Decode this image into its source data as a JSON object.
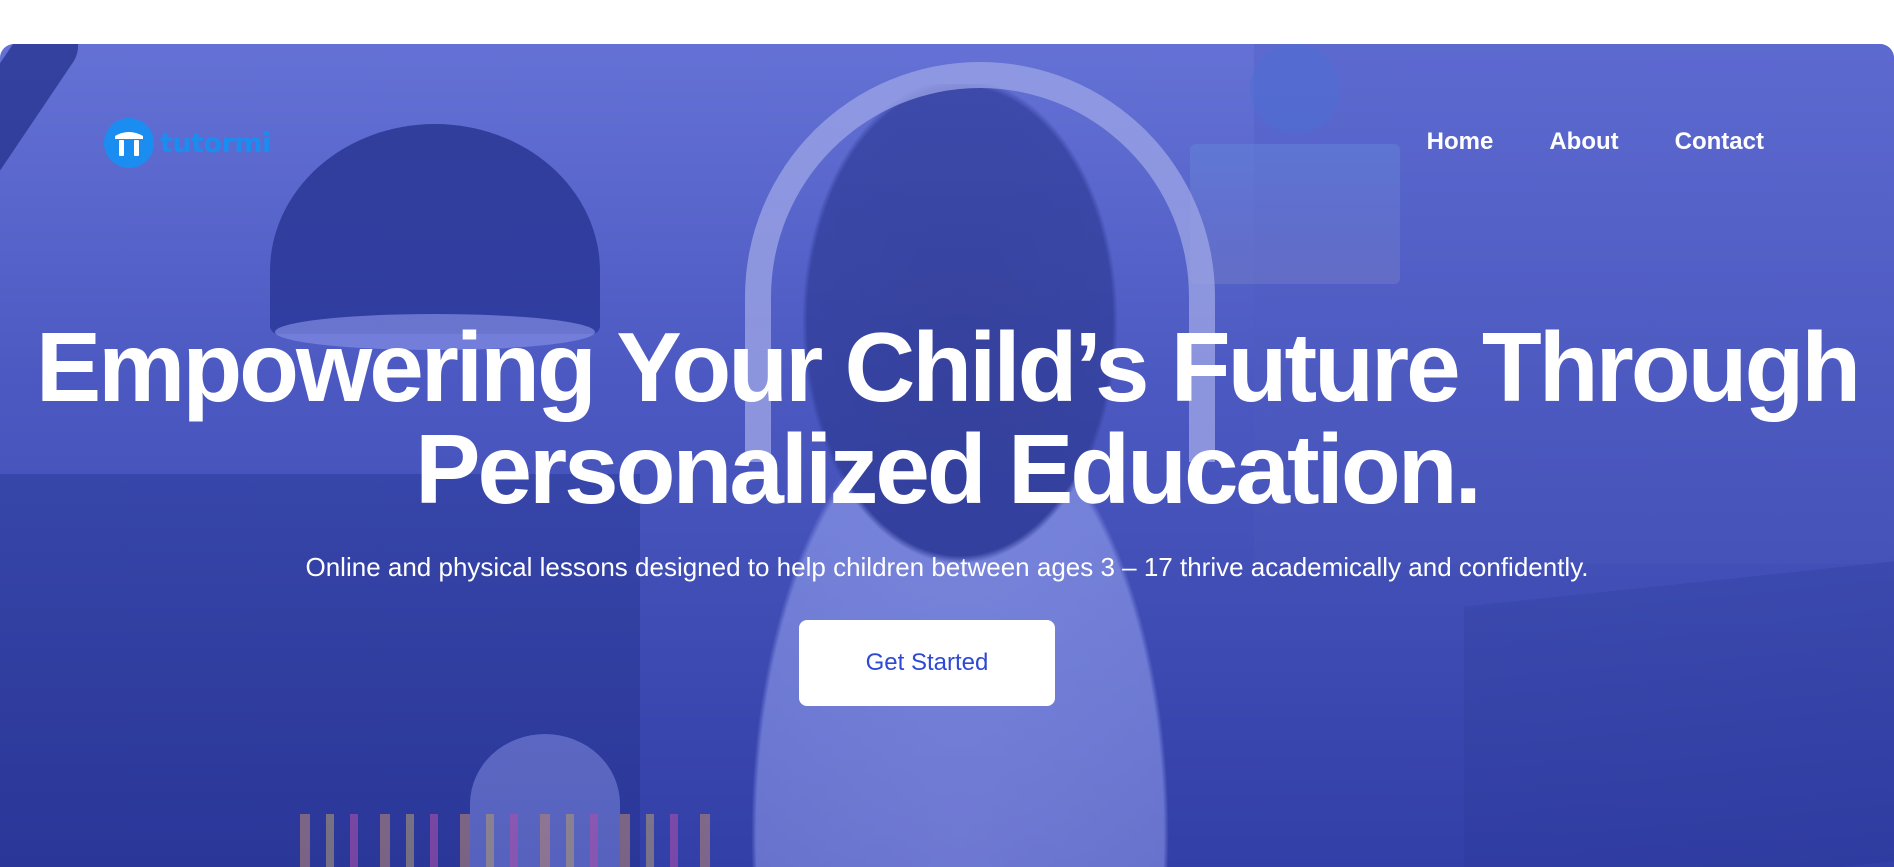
{
  "brand": {
    "name": "tutormi",
    "color": "#1b8df0"
  },
  "nav": {
    "items": [
      {
        "label": "Home"
      },
      {
        "label": "About"
      },
      {
        "label": "Contact"
      }
    ]
  },
  "hero": {
    "headline_line1": "Empowering Your Child’s Future Through",
    "headline_line2_start": "Personalized ",
    "headline_line2_highlight": "Education.",
    "subtitle": "Online and physical lessons designed to help children between ages 3 – 17 thrive academically and confidently.",
    "cta_label": "Get Started",
    "accent_color": "#3d52e8",
    "overlay_color": "#4f5cc0"
  }
}
